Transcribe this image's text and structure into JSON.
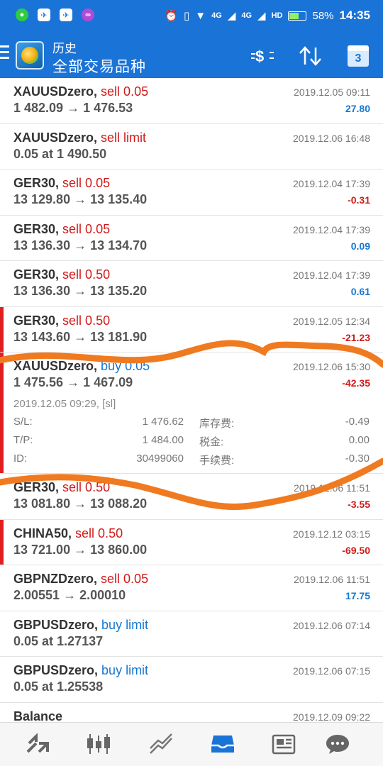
{
  "statusbar": {
    "left_icons": [
      "wechat-icon",
      "app-icon",
      "app-icon",
      "app-store-icon"
    ],
    "net1": "4G",
    "net2": "4G",
    "hd": "HD",
    "battery_percent": "58%",
    "battery_level": 0.58,
    "time": "14:35"
  },
  "appbar": {
    "title": "历史",
    "subtitle": "全部交易品种",
    "calendar_day": "3",
    "colors": {
      "primary": "#1a73d6",
      "sell": "#d11a1a",
      "buy": "#1677d2"
    }
  },
  "rows": [
    {
      "symbol": "XAUUSDzero,",
      "action": "sell 0.05",
      "side": "sell",
      "prices": "1 482.09 → 1 476.53",
      "time": "2019.12.05 09:11",
      "profit": "27.80",
      "sign": "pos",
      "marked": false
    },
    {
      "symbol": "XAUUSDzero,",
      "action": "sell limit",
      "side": "sell",
      "prices": "0.05 at 1 490.50",
      "time": "2019.12.06 16:48",
      "profit": "",
      "sign": "pos",
      "marked": false
    },
    {
      "symbol": "GER30,",
      "action": "sell 0.05",
      "side": "sell",
      "prices": "13 129.80 → 13 135.40",
      "time": "2019.12.04 17:39",
      "profit": "-0.31",
      "sign": "neg",
      "marked": false
    },
    {
      "symbol": "GER30,",
      "action": "sell 0.05",
      "side": "sell",
      "prices": "13 136.30 → 13 134.70",
      "time": "2019.12.04 17:39",
      "profit": "0.09",
      "sign": "pos",
      "marked": false
    },
    {
      "symbol": "GER30,",
      "action": "sell 0.50",
      "side": "sell",
      "prices": "13 136.30 → 13 135.20",
      "time": "2019.12.04 17:39",
      "profit": "0.61",
      "sign": "pos",
      "marked": false
    },
    {
      "symbol": "GER30,",
      "action": "sell 0.50",
      "side": "sell",
      "prices": "13 143.60 → 13 181.90",
      "time": "2019.12.05 12:34",
      "profit": "-21.23",
      "sign": "neg",
      "marked": true
    },
    {
      "symbol": "XAUUSDzero,",
      "action": "buy 0.05",
      "side": "buy",
      "prices": "1 475.56 → 1 467.09",
      "time": "2019.12.06 15:30",
      "profit": "-42.35",
      "sign": "neg",
      "marked": true,
      "expanded": true,
      "open_info": "2019.12.05 09:29, [sl]",
      "details": [
        {
          "label": "S/L:",
          "value": "1 476.62",
          "label2": "库存费:",
          "value2": "-0.49"
        },
        {
          "label": "T/P:",
          "value": "1 484.00",
          "label2": "税金:",
          "value2": "0.00"
        },
        {
          "label": "ID:",
          "value": "30499060",
          "label2": "手续费:",
          "value2": "-0.30"
        }
      ]
    },
    {
      "symbol": "GER30,",
      "action": "sell 0.50",
      "side": "sell",
      "prices": "13 081.80 → 13 088.20",
      "time": "2019.12.06 11:51",
      "profit": "-3.55",
      "sign": "neg",
      "marked": false
    },
    {
      "symbol": "CHINA50,",
      "action": "sell 0.50",
      "side": "sell",
      "prices": "13 721.00 → 13 860.00",
      "time": "2019.12.12 03:15",
      "profit": "-69.50",
      "sign": "neg",
      "marked": true
    },
    {
      "symbol": "GBPNZDzero,",
      "action": "sell 0.05",
      "side": "sell",
      "prices": "2.00551 → 2.00010",
      "time": "2019.12.06 11:51",
      "profit": "17.75",
      "sign": "pos",
      "marked": false
    },
    {
      "symbol": "GBPUSDzero,",
      "action": "buy limit",
      "side": "buy",
      "prices": "0.05 at 1.27137",
      "time": "2019.12.06 07:14",
      "profit": "",
      "sign": "pos",
      "marked": false
    },
    {
      "symbol": "GBPUSDzero,",
      "action": "buy limit",
      "side": "buy",
      "prices": "0.05 at 1.25538",
      "time": "2019.12.06 07:15",
      "profit": "",
      "sign": "pos",
      "marked": false
    },
    {
      "symbol": "Balance",
      "action": "",
      "side": "sell",
      "prices": "",
      "time": "2019.12.09 09:22",
      "profit": "",
      "sign": "pos",
      "marked": false
    }
  ],
  "bottomnav": {
    "items": [
      "quotes-icon",
      "charts-icon",
      "trade-icon",
      "history-icon",
      "news-icon",
      "chat-icon"
    ],
    "active": "history-icon",
    "active_color": "#1a73d6"
  }
}
